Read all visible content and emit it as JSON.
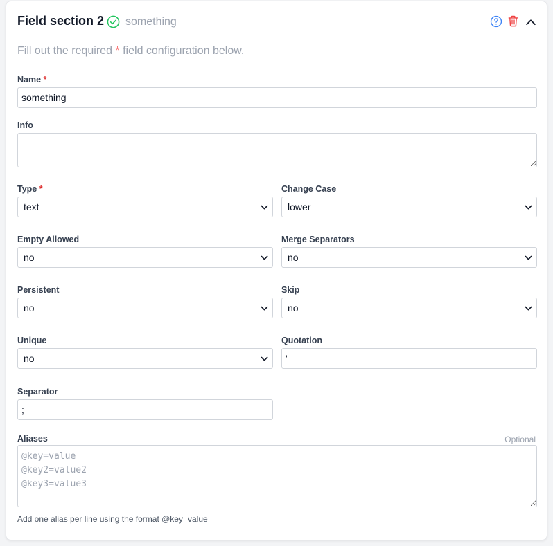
{
  "header": {
    "title": "Field section 2",
    "status_text": "something",
    "colors": {
      "check": "#22c55e",
      "help": "#3b82f6",
      "trash": "#ef4444"
    }
  },
  "intro": {
    "before": "Fill out the required",
    "asterisk": "*",
    "after": "field configuration below."
  },
  "fields": {
    "name": {
      "label": "Name",
      "required_mark": "*",
      "value": "something"
    },
    "info": {
      "label": "Info",
      "value": ""
    },
    "type": {
      "label": "Type",
      "required_mark": "*",
      "value": "text"
    },
    "change_case": {
      "label": "Change Case",
      "value": "lower"
    },
    "empty_allowed": {
      "label": "Empty Allowed",
      "value": "no"
    },
    "merge_separators": {
      "label": "Merge Separators",
      "value": "no"
    },
    "persistent": {
      "label": "Persistent",
      "value": "no"
    },
    "skip": {
      "label": "Skip",
      "value": "no"
    },
    "unique": {
      "label": "Unique",
      "value": "no"
    },
    "quotation": {
      "label": "Quotation",
      "value": "'"
    },
    "separator": {
      "label": "Separator",
      "value": ";"
    },
    "aliases": {
      "label": "Aliases",
      "optional_label": "Optional",
      "placeholder": "@key=value\n@key2=value2\n@key3=value3",
      "hint": "Add one alias per line using the format @key=value"
    }
  },
  "icons": {
    "status": "check-circle-icon",
    "help": "question-circle-icon",
    "delete": "trash-icon",
    "collapse": "chevron-up-icon",
    "select": "chevron-down-icon"
  }
}
